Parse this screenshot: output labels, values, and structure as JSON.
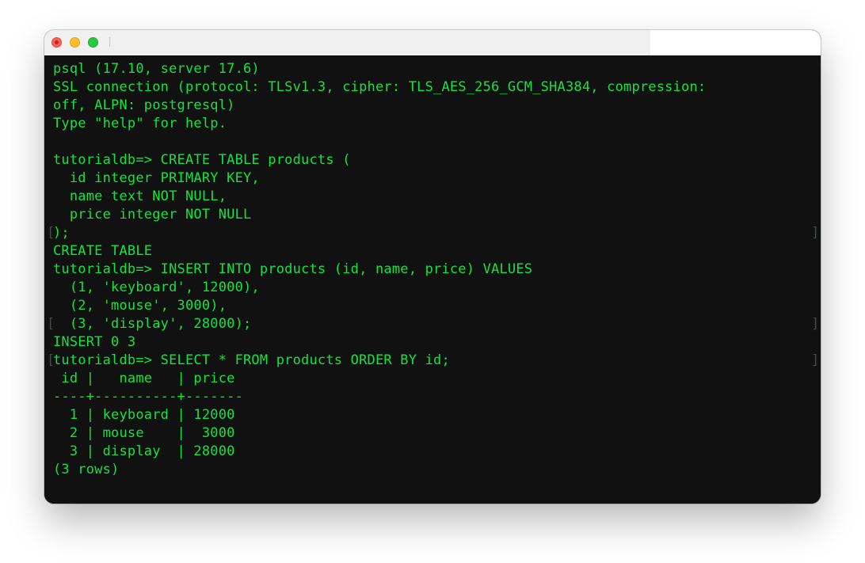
{
  "window": {
    "title": "",
    "titlebar_color": "#f0f0f0",
    "terminal_background": "#111111",
    "terminal_text_color": "#12e33f",
    "traffic_lights": [
      "close",
      "minimize",
      "zoom"
    ]
  },
  "terminal": {
    "lines": [
      "psql (17.10, server 17.6)",
      "SSL connection (protocol: TLSv1.3, cipher: TLS_AES_256_GCM_SHA384, compression:",
      "off, ALPN: postgresql)",
      "Type \"help\" for help.",
      "",
      "tutorialdb=> CREATE TABLE products (",
      "  id integer PRIMARY KEY,",
      "  name text NOT NULL,",
      "  price integer NOT NULL",
      ");",
      "CREATE TABLE",
      "tutorialdb=> INSERT INTO products (id, name, price) VALUES",
      "  (1, 'keyboard', 12000),",
      "  (2, 'mouse', 3000),",
      "  (3, 'display', 28000);",
      "INSERT 0 3",
      "tutorialdb=> SELECT * FROM products ORDER BY id;",
      " id |   name   | price",
      "----+----------+-------",
      "  1 | keyboard | 12000",
      "  2 | mouse    |  3000",
      "  3 | display  | 28000",
      "(3 rows)"
    ],
    "marker_left": "[",
    "marker_right": "]"
  }
}
